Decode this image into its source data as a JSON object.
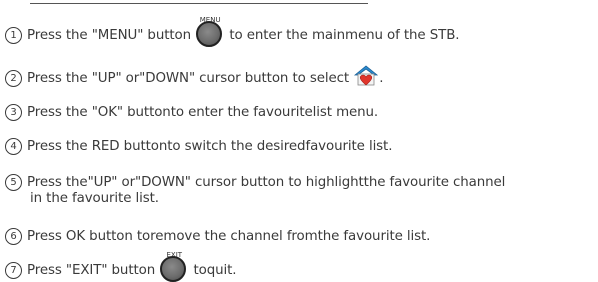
{
  "buttons": {
    "menu_caption": "MENU",
    "exit_caption": "EXIT"
  },
  "icons": {
    "favourite": "favourite-house-heart-icon",
    "button": "round-remote-button-icon"
  },
  "colors": {
    "text": "#3a3a3a",
    "button": "#6d6d6d",
    "heart": "#e0352b",
    "roof": "#2a8bd1"
  },
  "steps": [
    {
      "num": "1",
      "before": "Press the \"MENU\" button",
      "after": "to enter the mainmenu of the STB."
    },
    {
      "num": "2",
      "before": "Press the \"UP\" or\"DOWN\" cursor button to select",
      "after": "."
    },
    {
      "num": "3",
      "text": "Press the \"OK\" buttonto enter the favouritelist menu."
    },
    {
      "num": "4",
      "text": "Press the RED buttonto switch the desiredfavourite list."
    },
    {
      "num": "5",
      "line1": "Press the\"UP\" or\"DOWN\" cursor button to highlightthe favourite channel",
      "line2": "in the favourite list."
    },
    {
      "num": "6",
      "text": "Press OK button toremove the channel  fromthe favourite list."
    },
    {
      "num": "7",
      "before": "Press \"EXIT\" button",
      "after": "toquit."
    }
  ]
}
